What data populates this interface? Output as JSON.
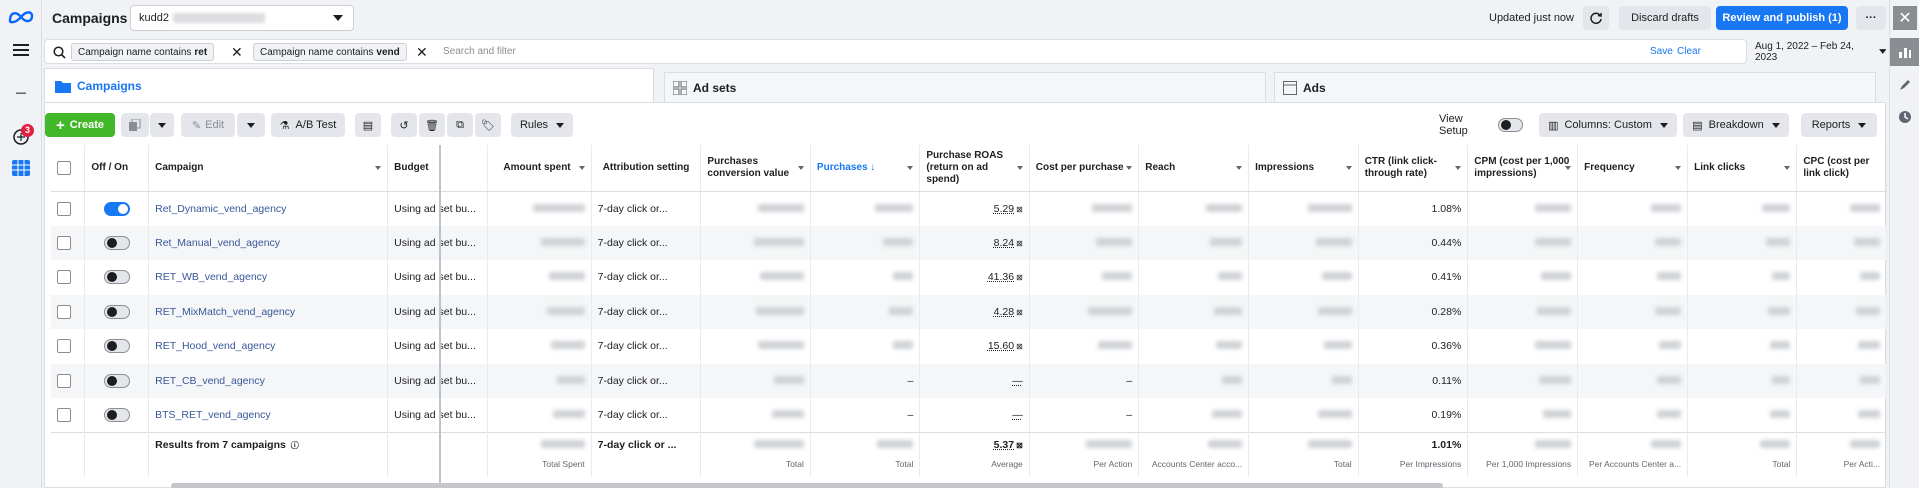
{
  "app": {
    "title": "Campaigns",
    "account_name": "kudd2"
  },
  "rail": {
    "notifications_count": "3"
  },
  "header": {
    "updated": "Updated just now",
    "discard_label": "Discard drafts",
    "publish_label": "Review and publish (1)",
    "more_label": "···"
  },
  "filter": {
    "chips": [
      {
        "prefix": "Campaign name contains",
        "value": "ret"
      },
      {
        "prefix": "Campaign name contains",
        "value": "vend"
      }
    ],
    "placeholder": "Search and filter",
    "save_label": "Save",
    "clear_label": "Clear",
    "date_range": "Aug 1, 2022 – Feb 24, 2023"
  },
  "tabs": [
    {
      "label": "Campaigns"
    },
    {
      "label": "Ad sets"
    },
    {
      "label": "Ads"
    }
  ],
  "toolbar": {
    "create_label": "Create",
    "edit_label": "Edit",
    "ab_test_label": "A/B Test",
    "rules_label": "Rules",
    "view_setup_label": "View Setup",
    "columns_label": "Columns: Custom",
    "breakdown_label": "Breakdown",
    "reports_label": "Reports"
  },
  "table": {
    "headers": {
      "onoff": "Off / On",
      "campaign": "Campaign",
      "budget": "Budget",
      "amount_spent": "Amount spent",
      "attribution": "Attribution setting",
      "pcv": "Purchases conversion value",
      "purchases": "Purchases ↓",
      "roas": "Purchase ROAS (return on ad spend)",
      "cpp": "Cost per purchase",
      "reach": "Reach",
      "impressions": "Impressions",
      "ctr": "CTR (link click-through rate)",
      "cpm": "CPM (cost per 1,000 impressions)",
      "frequency": "Frequency",
      "link_clicks": "Link clicks",
      "cpc": "CPC (cost per link click)"
    },
    "rows": [
      {
        "on": true,
        "name": "Ret_Dynamic_vend_agency",
        "budget": "Using ad set bu...",
        "attribution": "7-day click or...",
        "roas": "5.29",
        "ctr": "1.08%"
      },
      {
        "on": false,
        "name": "Ret_Manual_vend_agency",
        "budget": "Using ad set bu...",
        "attribution": "7-day click or...",
        "roas": "8.24",
        "ctr": "0.44%"
      },
      {
        "on": false,
        "name": "RET_WB_vend_agency",
        "budget": "Using ad set bu...",
        "attribution": "7-day click or...",
        "roas": "41.36",
        "ctr": "0.41%"
      },
      {
        "on": false,
        "name": "RET_MixMatch_vend_agency",
        "budget": "Using ad set bu...",
        "attribution": "7-day click or...",
        "roas": "4.28",
        "ctr": "0.28%"
      },
      {
        "on": false,
        "name": "RET_Hood_vend_agency",
        "budget": "Using ad set bu...",
        "attribution": "7-day click or...",
        "roas": "15.60",
        "ctr": "0.36%"
      },
      {
        "on": false,
        "name": "RET_CB_vend_agency",
        "budget": "Using ad set bu...",
        "attribution": "7-day click or...",
        "roas": "—",
        "ctr": "0.11%"
      },
      {
        "on": false,
        "name": "BTS_RET_vend_agency",
        "budget": "Using ad set bu...",
        "attribution": "7-day click or...",
        "roas": "—",
        "ctr": "0.19%"
      }
    ],
    "summary": {
      "label": "Results from 7 campaigns",
      "attribution": "7-day click or ...",
      "roas": "5.37",
      "ctr": "1.01%",
      "sub_spent": "Total Spent",
      "sub_pcv": "Total",
      "sub_purchases": "Total",
      "sub_roas": "Average",
      "sub_cpp": "Per Action",
      "sub_reach": "Accounts Center acco...",
      "sub_impressions": "Total",
      "sub_ctr": "Per Impressions",
      "sub_cpm": "Per 1,000 Impressions",
      "sub_frequency": "Per Accounts Center a...",
      "sub_link_clicks": "Total",
      "sub_cpc": "Per Acti..."
    }
  }
}
